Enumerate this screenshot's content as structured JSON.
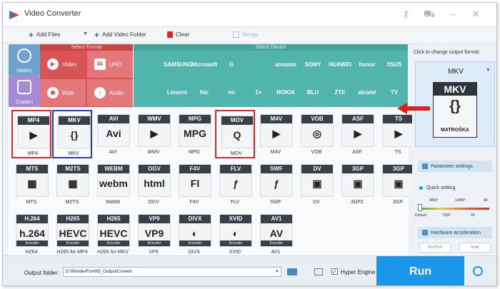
{
  "app": {
    "title": "Video Converter"
  },
  "toolbar": {
    "add_files": "Add Files",
    "add_folder": "Add Video Folder",
    "clear": "Clear",
    "merge": "Merge"
  },
  "left_tabs": {
    "history": "History",
    "custom": "Custom"
  },
  "format_panel": {
    "header": "Select Format",
    "categories": [
      {
        "label": "Video",
        "icon": "play-icon"
      },
      {
        "label": "UHD",
        "icon": "4k-icon"
      },
      {
        "label": "Web",
        "icon": "web-icon"
      },
      {
        "label": "Audio",
        "icon": "audio-icon"
      }
    ]
  },
  "device_panel": {
    "header": "Select Device",
    "brands": [
      "",
      "SAMSUNG",
      "Microsoft",
      "G",
      "",
      "amazon",
      "SONY",
      "HUAWEI",
      "honor",
      "/ISUS",
      "",
      "Lenovo",
      "htc",
      "mi",
      "1+",
      "NOKIA",
      "BLU",
      "ZTE",
      "alcatel",
      "TV"
    ]
  },
  "formats": [
    {
      "band": "MP4",
      "glyph": "▶",
      "label": "MP4"
    },
    {
      "band": "MKV",
      "glyph": "{}",
      "label": "MKV"
    },
    {
      "band": "AVI",
      "glyph": "Avi",
      "label": "AVI"
    },
    {
      "band": "WMV",
      "glyph": "▶",
      "label": "WMV"
    },
    {
      "band": "MPG",
      "glyph": "MPG",
      "label": "MPG"
    },
    {
      "band": "MOV",
      "glyph": "Q",
      "label": "MOV"
    },
    {
      "band": "M4V",
      "glyph": "▶",
      "label": "M4V"
    },
    {
      "band": "VOB",
      "glyph": "◎",
      "label": "VOB"
    },
    {
      "band": "ASF",
      "glyph": "▶",
      "label": "ASF"
    },
    {
      "band": "TS",
      "glyph": "▶",
      "label": "TS"
    },
    {
      "band": "MTS",
      "glyph": "▦",
      "label": "MTS"
    },
    {
      "band": "M2TS",
      "glyph": "▦",
      "label": "M2TS"
    },
    {
      "band": "WEBM",
      "glyph": "webm",
      "label": "WebM"
    },
    {
      "band": "OGV",
      "glyph": "html",
      "label": "OGV"
    },
    {
      "band": "F4V",
      "glyph": "Fl",
      "label": "F4V"
    },
    {
      "band": "FLV",
      "glyph": "ƒ",
      "label": "FLV"
    },
    {
      "band": "SWF",
      "glyph": "ƒ",
      "label": "SWF"
    },
    {
      "band": "DV",
      "glyph": "▣",
      "label": "DV"
    },
    {
      "band": "3GP",
      "glyph": "▣",
      "label": "3GP2"
    },
    {
      "band": "3GP",
      "glyph": "▣",
      "label": "3GP"
    },
    {
      "band": "H.264",
      "glyph": "h.264",
      "label": "H264",
      "encoder": "Encoder"
    },
    {
      "band": "H265",
      "glyph": "HEVC",
      "label": "H265 for MP4",
      "encoder": "Encoder"
    },
    {
      "band": "H265",
      "glyph": "HEVC",
      "label": "H265 for MKV",
      "encoder": "Encoder"
    },
    {
      "band": "VP9",
      "glyph": "VP9",
      "label": "VP9",
      "encoder": "Encoder"
    },
    {
      "band": "DIVX",
      "glyph": "◐",
      "label": "DIVX",
      "encoder": "Encoder"
    },
    {
      "band": "XVID",
      "glyph": "◐",
      "label": "XVID",
      "encoder": "Encoder"
    },
    {
      "band": "AV1",
      "glyph": "AV",
      "label": "AV1",
      "encoder": "Encoder"
    }
  ],
  "right_panel": {
    "hint": "Click to change output format:",
    "format": "MKV",
    "icon_band": "MKV",
    "icon_glyph": "{}",
    "icon_brand": "MATROŠKA",
    "param_settings": "Parameter settings",
    "quick_setting": "Quick setting",
    "quality_top": [
      "480P",
      "1080P",
      "4K"
    ],
    "quality_bottom": [
      "Default",
      "720P",
      "2K"
    ],
    "hw_accel": "Hardware acceleration",
    "gpu": [
      "NVIDIA",
      "Intel"
    ]
  },
  "bottom": {
    "output_label": "Output folder:",
    "output_path": "D:\\WonderFox\\HD_Output\\Convert",
    "hyper_engine": "Hyper Engine",
    "hyper_checked": "✓",
    "run": "Run"
  }
}
